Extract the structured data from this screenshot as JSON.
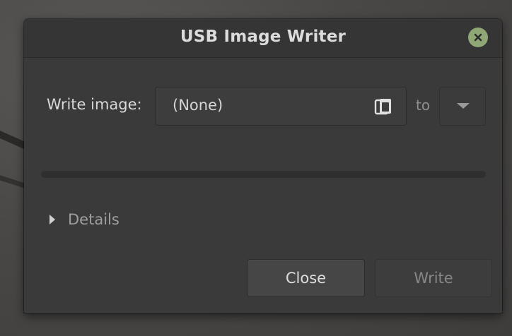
{
  "window": {
    "title": "USB Image Writer"
  },
  "form": {
    "write_image_label": "Write image:",
    "image_value": "(None)",
    "to_label": "to",
    "device_value": ""
  },
  "progress": {
    "fraction": 0
  },
  "details": {
    "label": "Details",
    "expanded": false
  },
  "buttons": {
    "close_label": "Close",
    "write_label": "Write",
    "write_enabled": false
  },
  "icons": {
    "titlebar_close": "close-icon",
    "file_chooser": "folder-icon",
    "dropdown": "chevron-down-icon",
    "expander": "chevron-right-icon"
  },
  "colors": {
    "accent": "#8fa876",
    "window_bg": "#3a3a3a",
    "titlebar_bg": "#353535"
  }
}
